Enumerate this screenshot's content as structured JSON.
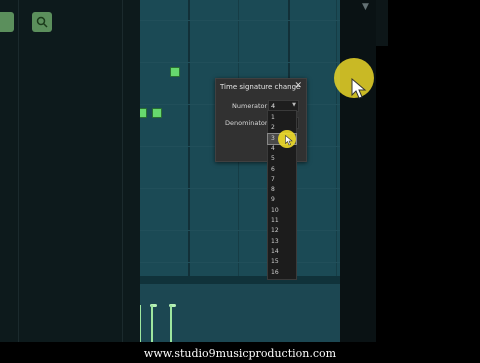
{
  "dialog": {
    "title": "Time signature change",
    "close_icon": "close-icon",
    "numerator_label": "Numerator",
    "denominator_label": "Denominator",
    "numerator_value": "4"
  },
  "dropdown": {
    "options": [
      "1",
      "2",
      "3",
      "4",
      "5",
      "6",
      "7",
      "8",
      "9",
      "10",
      "11",
      "12",
      "13",
      "14",
      "15",
      "16"
    ],
    "highlighted": "3"
  },
  "toolbar": {
    "left_button_icon": "green-button-icon",
    "search_icon": "search-icon"
  },
  "caption": "www.studio9musicproduction.com",
  "colors": {
    "roll_bg": "#1b4a55",
    "note": "#67d86e",
    "dialog_bg": "#313131",
    "cursor_halo": "#ebd728"
  }
}
